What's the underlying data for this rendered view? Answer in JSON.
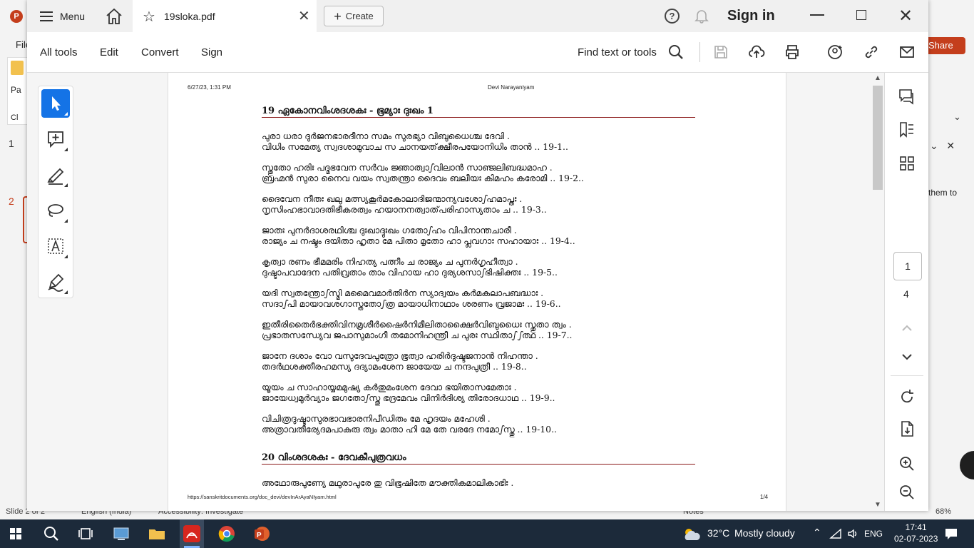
{
  "background_app": {
    "file_menu": "File",
    "ribbon_label": "Pa",
    "ribbon_label2": "Cl",
    "slide_nums": [
      "1",
      "2"
    ],
    "share_label": "Share",
    "panel_text": "them to",
    "status_slide": "Slide 2 of 2",
    "status_lang": "English (India)",
    "status_access": "Accessibility: Investigate",
    "status_notes": "Notes",
    "status_zoom": "68%"
  },
  "titlebar": {
    "menu_label": "Menu",
    "tab_name": "19sloka.pdf",
    "create_label": "Create",
    "help_glyph": "?",
    "signin_label": "Sign in"
  },
  "toolbar": {
    "items": [
      "All tools",
      "Edit",
      "Convert",
      "Sign"
    ],
    "find_label": "Find text or tools"
  },
  "page": {
    "header_left": "6/27/23, 1:31 PM",
    "header_center": "Devi Narayaniyam",
    "footer_left": "https://sanskritdocuments.org/doc_devi/devInArAyaNIyam.html",
    "footer_right": "1/4",
    "section1_title": "19 ഏകോനവിംശദശകഃ -   ഭൂമ്യാഃ ദുഃഖം 1",
    "verses": [
      [
        "പുരാ ധരാ ദുർജനഭാരദീനാ സമം സുരഭ്യാ വിബുധൈശ്ച ദേവി .",
        "വിധിം സമേത്യ സ്വദശാമുവാച സ ചാനയത്‌ക്ഷീരപയോനിധിം താൻ .. 19-1.."
      ],
      [
        "സ്തുതോ ഹരിഃ പദ്മഭവേന സർവം ജ്ഞാത്വാഽവിലാൻ സാഞ്ജലിബദ്ധമാഹ .",
        "ബ്രഹ്മൻ സുരാ നൈവ വയം സ്വതന്ത്രാ ദൈവം ബലീയഃ കിമഹം കരോമി .. 19-2.."
      ],
      [
        "ദൈവേന നീതഃ ഖലു മത്സ്യകൂർമകോലാദിജന്മാന്യവശോഽഹമാപ്തഃ .",
        "നൃസിംഹഭാവാദതിഭീകരത്വം ഹയാനനത്വാത്‌പരിഹാസ്യതാം ച .. 19-3.."
      ],
      [
        "ജാതഃ പുനർദാശരഥിശ്ച ദുഃഖാദ്ദുഃഖം ഗതോഽഹം വിപിനാന്തചാരീ .",
        "രാജ്യം ച നഷ്ടം ദയിതാ ഹൃതാ മേ പിതാ മൃതോ ഹാ പ്ലവഗാഃ സഹായാഃ .. 19-4.."
      ],
      [
        "കൃത്വാ രണം ഭീമമരിം നിഹത്യ പത്നീം ച രാജ്യം ച പുനർഗൃഹീത്വാ .",
        "ദുഷ്ടാപവാദേന പതിവ്രതാം താം വിഹായ ഹാ ദുര്യശസാഽഭിഷിക്തഃ .. 19-5.."
      ],
      [
        "യദി സ്വതന്ത്രോഽസ്മി മമൈവമാർതിർന സ്യാദ്വയം കർമകലാപബദ്ധാഃ .",
        "സദാഽപി മായാവശഗാസ്തതോഽത്ര മായാധിനാഥാം ശരണം വ്രജാമഃ .. 19-6.."
      ],
      [
        "ഇതീരിതൈർഭക്തിവിനമ്രശീർഷൈർനിമീലിതാക്ഷൈർവിബുധൈഃ സ്തുതാ ത്വം .",
        "പ്രഭാതസന്ധ്യേവ ജപാസുമാംഗീ തമോനിഹന്ത്രീ ച പുരഃ സ്ഥിതാഽഽത്ഥ .. 19-7.."
      ],
      [
        "ജാനേ ദശാം വോ വസുദേവപുത്രോ ഭൂത്വാ ഹരിർദുഷ്ടജനാൻ നിഹന്താ .",
        "തദർഥശക്തീരഹമസ്യ ദദ്യാമംശേന ജായേയ ച നന്ദപുത്രീ .. 19-8.."
      ],
      [
        "യൂയം ച സാഹായ്യമമുഷ്യ കർതുമംശേന ദേവാ ഭയിതാസമേതാഃ .",
        "ജായേധ്വമുർവ്യാം ജഗതോഽസ്തു ഭദ്രമേവം വിനിർദിശ്യ തിരോദധാഥ .. 19-9.."
      ],
      [
        "വിചിത്രദുഷ്ടാസുരഭാവഭാരനിപീഡിതം മേ ഹൃദയം മഹേശി .",
        "അത്രാവതീര്യേദമപാകുരു ത്വം മാതാ ഹി മേ തേ വരദേ നമോഽസ്തു .. 19-10.."
      ]
    ],
    "section2_title": "20 വിംശദശകഃ -   ദേവകീപുത്രവധം",
    "verse_partial": "അഥോരുപുണ്യേ മഥുരാപുരേ തു വിഭൂഷിതേ മൗക്തികമാലികാഭിഃ ."
  },
  "right_panel": {
    "current_page": "1",
    "total_pages": "4"
  },
  "taskbar": {
    "weather_temp": "32°C",
    "weather_desc": "Mostly cloudy",
    "lang": "ENG",
    "time": "17:41",
    "date": "02-07-2023"
  },
  "colors": {
    "accent": "#1473e6",
    "section_rule": "#8b1a1a",
    "ppt_brand": "#c43e1c",
    "taskbar": "#1c2a3a"
  }
}
